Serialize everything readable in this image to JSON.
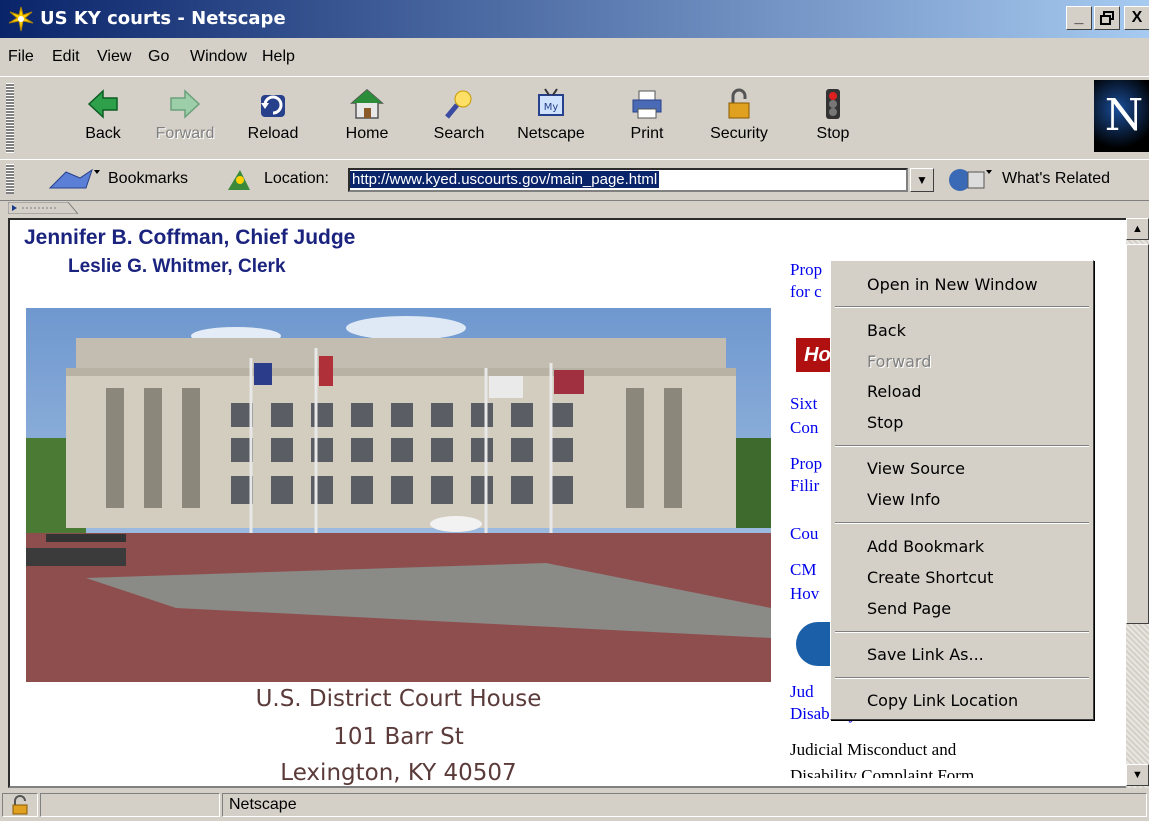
{
  "window": {
    "title": "US KY courts - Netscape",
    "buttons": {
      "minimize": "_",
      "maximize": "▫",
      "close": "X"
    }
  },
  "menubar": [
    "File",
    "Edit",
    "View",
    "Go",
    "Window",
    "Help"
  ],
  "toolbar": {
    "back": "Back",
    "forward": "Forward",
    "reload": "Reload",
    "home": "Home",
    "search": "Search",
    "netscape": "Netscape",
    "print": "Print",
    "security": "Security",
    "stop": "Stop",
    "netscape_icon_text": "My",
    "logo": "N"
  },
  "location_bar": {
    "bookmarks": "Bookmarks",
    "location_label": "Location:",
    "url": "http://www.kyed.uscourts.gov/main_page.html",
    "whats_related": "What's Related"
  },
  "page": {
    "judge": "Jennifer B. Coffman, Chief Judge",
    "clerk": "Leslie G. Whitmer, Clerk",
    "caption": [
      "U.S. District Court House",
      "101 Barr St",
      "Lexington, KY  40507"
    ],
    "right_links": [
      "Prop",
      "for c",
      "Sixt",
      "Con",
      "Prop",
      "Filir",
      "Cou",
      "CM",
      "Hov",
      "Jud",
      "Disability Rules"
    ],
    "hot_badge": "Hot",
    "right_text": "Judicial Misconduct and",
    "right_text_cut": "Disability Complaint Form"
  },
  "context_menu": {
    "open_new_window": "Open in New Window",
    "back": "Back",
    "forward": "Forward",
    "reload": "Reload",
    "stop": "Stop",
    "view_source": "View Source",
    "view_info": "View Info",
    "add_bookmark": "Add Bookmark",
    "create_shortcut": "Create Shortcut",
    "send_page": "Send Page",
    "save_link_as": "Save Link As...",
    "copy_link_location": "Copy Link Location"
  },
  "statusbar": {
    "text": "Netscape"
  }
}
